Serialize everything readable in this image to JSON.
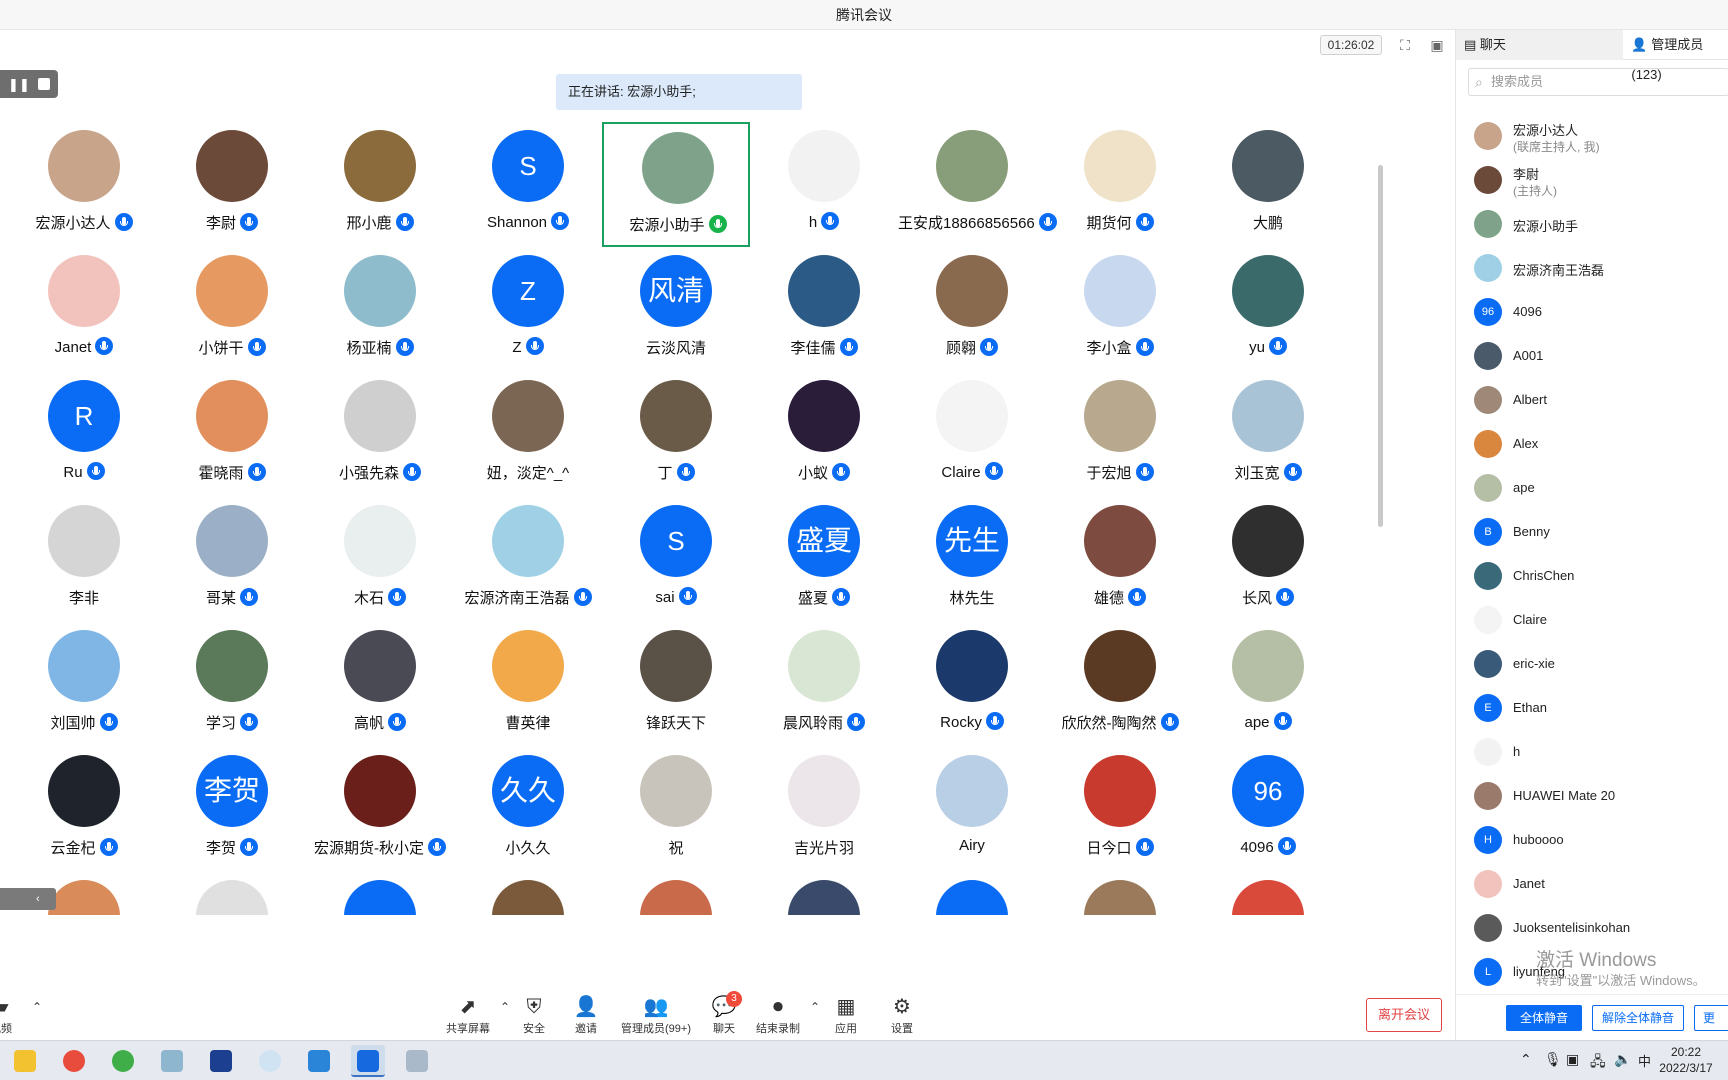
{
  "window_title": "腾讯会议",
  "topbar": {
    "timer": "01:26:02"
  },
  "speaking_text": "正在讲话: 宏源小助手;",
  "grid": [
    {
      "name": "宏源小达人",
      "mic": true,
      "avatar": "photo",
      "color": "#c8a48a"
    },
    {
      "name": "李尉",
      "mic": true,
      "avatar": "photo",
      "color": "#6b4a3a"
    },
    {
      "name": "邢小鹿",
      "mic": true,
      "avatar": "photo",
      "color": "#8b6b3c"
    },
    {
      "name": "Shannon",
      "mic": true,
      "avatar": "letter",
      "letter": "S"
    },
    {
      "name": "宏源小助手",
      "mic": true,
      "mic_color": "green",
      "avatar": "photo",
      "color": "#7fa38a",
      "active": true
    },
    {
      "name": "h",
      "mic": true,
      "avatar": "photo",
      "color": "#f2f2f2"
    },
    {
      "name": "王安成18866856566",
      "mic": true,
      "avatar": "photo",
      "color": "#889e7a"
    },
    {
      "name": "期货何",
      "mic": true,
      "avatar": "photo",
      "color": "#efe2c8"
    },
    {
      "name": "大鹏",
      "mic": false,
      "avatar": "photo",
      "color": "#4c5a63"
    },
    {
      "name": "Janet",
      "mic": true,
      "avatar": "photo",
      "color": "#f2c3bd"
    },
    {
      "name": "小饼干",
      "mic": true,
      "avatar": "photo",
      "color": "#e69a62"
    },
    {
      "name": "杨亚楠",
      "mic": true,
      "avatar": "photo",
      "color": "#8fbccc"
    },
    {
      "name": "Z",
      "mic": true,
      "avatar": "letter",
      "letter": "Z"
    },
    {
      "name": "云淡风清",
      "mic": false,
      "avatar": "letter",
      "letter": "风清",
      "cjk": true
    },
    {
      "name": "李佳儒",
      "mic": true,
      "avatar": "photo",
      "color": "#2b5a86"
    },
    {
      "name": "顾翱",
      "mic": true,
      "avatar": "photo",
      "color": "#8a6a4e"
    },
    {
      "name": "李小盒",
      "mic": true,
      "avatar": "photo",
      "color": "#c8d8ef"
    },
    {
      "name": "yu",
      "mic": true,
      "avatar": "photo",
      "color": "#3a6b6a"
    },
    {
      "name": "Ru",
      "mic": true,
      "avatar": "letter",
      "letter": "R"
    },
    {
      "name": "霍晓雨",
      "mic": true,
      "avatar": "photo",
      "color": "#e28f5d"
    },
    {
      "name": "小强先森",
      "mic": true,
      "avatar": "photo",
      "color": "#cfcfcf"
    },
    {
      "name": "妞，淡定^_^",
      "mic": false,
      "avatar": "photo",
      "color": "#7a6653"
    },
    {
      "name": "丁",
      "mic": true,
      "avatar": "photo",
      "color": "#6a5a48"
    },
    {
      "name": "小蚁",
      "mic": true,
      "avatar": "photo",
      "color": "#2a1d3a"
    },
    {
      "name": "Claire",
      "mic": true,
      "avatar": "photo",
      "color": "#f4f4f4"
    },
    {
      "name": "于宏旭",
      "mic": true,
      "avatar": "photo",
      "color": "#b8a98e"
    },
    {
      "name": "刘玉宽",
      "mic": true,
      "avatar": "photo",
      "color": "#a8c2d6"
    },
    {
      "name": "李非",
      "mic": false,
      "avatar": "photo",
      "color": "#d5d5d5"
    },
    {
      "name": "哥某",
      "mic": true,
      "avatar": "photo",
      "color": "#9bb0c6"
    },
    {
      "name": "木石",
      "mic": true,
      "avatar": "photo",
      "color": "#e9eeee"
    },
    {
      "name": "宏源济南王浩磊",
      "mic": true,
      "avatar": "photo",
      "color": "#9fd0e6"
    },
    {
      "name": "sai",
      "mic": true,
      "avatar": "letter",
      "letter": "S"
    },
    {
      "name": "盛夏",
      "mic": true,
      "avatar": "letter",
      "letter": "盛夏",
      "cjk": true
    },
    {
      "name": "林先生",
      "mic": false,
      "avatar": "letter",
      "letter": "先生",
      "cjk": true
    },
    {
      "name": "雄德",
      "mic": true,
      "avatar": "photo",
      "color": "#7d4b3f"
    },
    {
      "name": "长风",
      "mic": true,
      "avatar": "photo",
      "color": "#2f2f2f"
    },
    {
      "name": "刘国帅",
      "mic": true,
      "avatar": "photo",
      "color": "#7fb6e6"
    },
    {
      "name": "学习",
      "mic": true,
      "avatar": "photo",
      "color": "#5a7a5a"
    },
    {
      "name": "高帆",
      "mic": true,
      "avatar": "photo",
      "color": "#4a4a55"
    },
    {
      "name": "曹英律",
      "mic": false,
      "avatar": "photo",
      "color": "#f1a94a"
    },
    {
      "name": "锋跃天下",
      "mic": false,
      "avatar": "photo",
      "color": "#5a5147"
    },
    {
      "name": "晨风聆雨",
      "mic": true,
      "avatar": "photo",
      "color": "#d9e6d3"
    },
    {
      "name": "Rocky",
      "mic": true,
      "avatar": "photo",
      "color": "#1b3a6b"
    },
    {
      "name": "欣欣然-陶陶然",
      "mic": true,
      "avatar": "photo",
      "color": "#5a3a22"
    },
    {
      "name": "ape",
      "mic": true,
      "avatar": "photo",
      "color": "#b5bfa5"
    },
    {
      "name": "云金杞",
      "mic": true,
      "avatar": "photo",
      "color": "#1f242c"
    },
    {
      "name": "李贺",
      "mic": true,
      "avatar": "letter",
      "letter": "李贺",
      "cjk": true
    },
    {
      "name": "宏源期货-秋小定",
      "mic": true,
      "avatar": "photo",
      "color": "#6a1f1a"
    },
    {
      "name": "小久久",
      "mic": false,
      "avatar": "letter",
      "letter": "久久",
      "cjk": true
    },
    {
      "name": "祝",
      "mic": false,
      "avatar": "photo",
      "color": "#c9c4bb"
    },
    {
      "name": "吉光片羽",
      "mic": false,
      "avatar": "photo",
      "color": "#ece6ea"
    },
    {
      "name": "Airy",
      "mic": false,
      "avatar": "photo",
      "color": "#b9cfe6"
    },
    {
      "name": "日今口",
      "mic": true,
      "avatar": "photo",
      "color": "#c93a2e"
    },
    {
      "name": "4096",
      "mic": true,
      "avatar": "letter",
      "letter": "96"
    }
  ],
  "toolbar": {
    "video": "视频",
    "share": "共享屏幕",
    "security": "安全",
    "invite": "邀请",
    "manage": "管理成员(99+)",
    "chat": "聊天",
    "chat_badge": "3",
    "record": "结束录制",
    "apps": "应用",
    "settings": "设置",
    "leave": "离开会议"
  },
  "side": {
    "tab_chat": "聊天",
    "tab_members": "管理成员(123)",
    "search_placeholder": "搜索成员",
    "members": [
      {
        "name": "宏源小达人",
        "role": "(联席主持人, 我)",
        "avatar": "photo",
        "color": "#c8a48a"
      },
      {
        "name": "李尉",
        "role": "(主持人)",
        "avatar": "photo",
        "color": "#6b4a3a"
      },
      {
        "name": "宏源小助手",
        "avatar": "photo",
        "color": "#7fa38a"
      },
      {
        "name": "宏源济南王浩磊",
        "avatar": "photo",
        "color": "#9fd0e6"
      },
      {
        "name": "4096",
        "avatar": "letter",
        "letter": "96"
      },
      {
        "name": "A001",
        "avatar": "photo",
        "color": "#4a5a6b"
      },
      {
        "name": "Albert",
        "avatar": "photo",
        "color": "#a08878"
      },
      {
        "name": "Alex",
        "avatar": "photo",
        "color": "#d9873e"
      },
      {
        "name": "ape",
        "avatar": "photo",
        "color": "#b5bfa5"
      },
      {
        "name": "Benny",
        "avatar": "letter",
        "letter": "B"
      },
      {
        "name": "ChrisChen",
        "avatar": "photo",
        "color": "#3a6a7a"
      },
      {
        "name": "Claire",
        "avatar": "photo",
        "color": "#f4f4f4"
      },
      {
        "name": "eric-xie",
        "avatar": "photo",
        "color": "#3a5a7a"
      },
      {
        "name": "Ethan",
        "avatar": "letter",
        "letter": "E"
      },
      {
        "name": "h",
        "avatar": "photo",
        "color": "#f2f2f2"
      },
      {
        "name": "HUAWEI Mate 20",
        "avatar": "photo",
        "color": "#9a7a6a"
      },
      {
        "name": "huboooo",
        "avatar": "letter",
        "letter": "H"
      },
      {
        "name": "Janet",
        "avatar": "photo",
        "color": "#f2c3bd"
      },
      {
        "name": "Juoksentelisinkohan",
        "avatar": "photo",
        "color": "#5a5a5a"
      },
      {
        "name": "liyunfeng",
        "avatar": "letter",
        "letter": "L"
      }
    ],
    "mute_all": "全体静音",
    "unmute_all": "解除全体静音",
    "more": "更"
  },
  "watermark": {
    "line1": "激活 Windows",
    "line2": "转到\"设置\"以激活 Windows。"
  },
  "taskbar": {
    "ime": "中",
    "time": "20:22",
    "date": "2022/3/17"
  },
  "colors": {
    "accent": "#0a6cf5",
    "active_border": "#1aa15f",
    "leave": "#e04545"
  }
}
